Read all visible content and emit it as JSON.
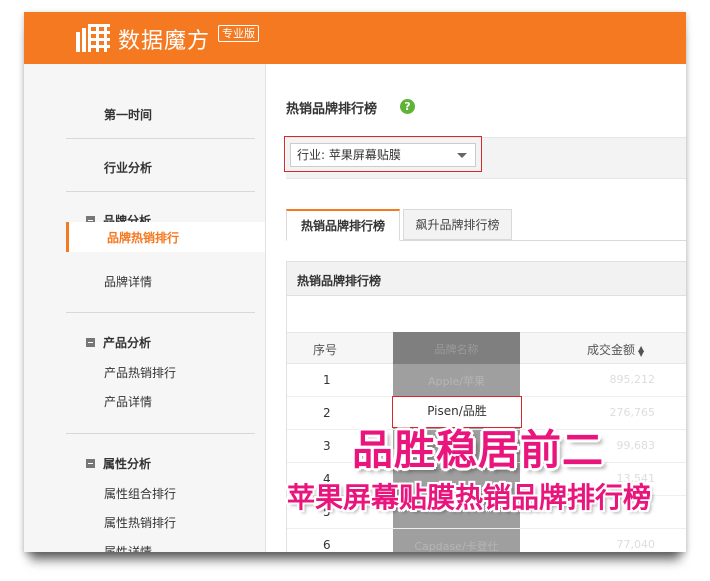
{
  "app": {
    "title": "数据魔方",
    "edition": "专业版"
  },
  "sidebar": {
    "first": "第一时间",
    "industry": "行业分析",
    "groups": [
      {
        "label": "品牌分析",
        "items": [
          "品牌热销排行",
          "品牌详情"
        ]
      },
      {
        "label": "产品分析",
        "items": [
          "产品热销排行",
          "产品详情"
        ]
      },
      {
        "label": "属性分析",
        "items": [
          "属性组合排行",
          "属性热销排行",
          "属性详情"
        ]
      }
    ]
  },
  "main": {
    "title": "热销品牌排行榜",
    "help": "?",
    "filter": "行业: 苹果屏幕贴膜",
    "tabs": [
      "热销品牌排行榜",
      "飙升品牌排行榜"
    ],
    "panel_title": "热销品牌排行榜",
    "columns": [
      "序号",
      "品牌名称",
      "成交金额"
    ],
    "rows": [
      {
        "rank": "1",
        "brand": "Apple/苹果",
        "amount": "895,212"
      },
      {
        "rank": "2",
        "brand": "Pisen/品胜",
        "amount": "276,765"
      },
      {
        "rank": "3",
        "brand": "",
        "amount": "99,683"
      },
      {
        "rank": "4",
        "brand": "",
        "amount": "13,541"
      },
      {
        "rank": "5",
        "brand": "",
        "amount": ""
      },
      {
        "rank": "6",
        "brand": "Capdase/卡登仕",
        "amount": "77,040"
      }
    ]
  },
  "overlay": {
    "headline": "品胜稳居前二",
    "subline": "苹果屏幕贴膜热销品牌排行榜"
  },
  "colors": {
    "brand_orange": "#f47920",
    "highlight_red": "#d9272e",
    "overlay_pink": "#e9157d",
    "help_green": "#5fb336"
  }
}
